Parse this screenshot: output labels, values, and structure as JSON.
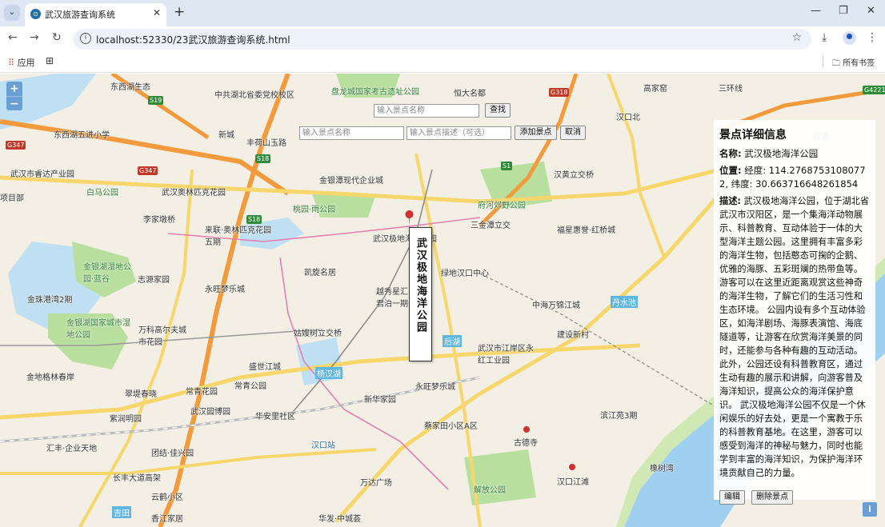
{
  "browser": {
    "tab_title": "武汉旅游查询系统",
    "tab_close": "✕",
    "new_tab": "+",
    "minimize": "—",
    "restore": "❐",
    "close": "✕",
    "url": "localhost:52330/23武汉旅游查询系统.html",
    "bookmarks_apps": "应用",
    "bookmarks_all": "所有书签"
  },
  "map": {
    "zoom_in": "+",
    "zoom_out": "−",
    "info": "i",
    "labels": [
      "中共湖北省委党校校区",
      "盘龙城国家考古遗址公园",
      "恒大名都",
      "高家窑",
      "东西湖生态",
      "后湖",
      "三环线",
      "汉口北",
      "东西湖五进小学",
      "丰荷山玉路",
      "新城",
      "武汉市睿达产业园",
      "白马公园",
      "武汉奥林匹克花园",
      "李家墩桥",
      "桃园·雨公园",
      "金银潭现代企业城",
      "府河郊野公园",
      "汉黄立交桥",
      "三金潭立交",
      "福星惠誉·红桥城",
      "武汉极地海洋公园",
      "来联·奥林匹克花园五期",
      "凯旋名居",
      "绿地汉口中心",
      "志源家园",
      "金银湖湿地公园·蓝谷",
      "永旺梦乐城",
      "越秀星汇君泊一期",
      "金珠港湾2期",
      "中海万锦江城",
      "丹水池",
      "金银湖国家城市湿地公园",
      "万科高尔夫城市花园",
      "姑嫂树立交桥",
      "后湖",
      "建设新村",
      "盛世江城",
      "杨汉湖",
      "武汉市江岸区永红工业园",
      "金地格林春岸",
      "常青花园",
      "永旺梦乐城",
      "常青公园",
      "新华家园",
      "翠堤春晓",
      "武汉园博园",
      "紫润明园",
      "华安里社区",
      "蔡家田小区A区",
      "滨江苑3期",
      "汉口站",
      "古德寺",
      "汇丰·企业天地",
      "团结·佳兴园",
      "长丰大道高架",
      "万达广场",
      "解放公园",
      "汉口江滩",
      "橡树湾",
      "云鹤小区",
      "吉田",
      "香江家居",
      "华发·中城荟",
      "项目部"
    ],
    "road_badges": [
      "S19",
      "G347",
      "G347",
      "S18",
      "S18",
      "S1",
      "G318",
      "G4221"
    ]
  },
  "search": {
    "name_placeholder": "输入景点名称",
    "find_label": "查找",
    "add_name_placeholder": "输入景点名称",
    "add_desc_placeholder": "输入景点描述（可选）",
    "add_label": "添加景点",
    "cancel_label": "取消"
  },
  "popup": {
    "title": "武汉极地海洋公园"
  },
  "detail": {
    "heading": "景点详细信息",
    "name_key": "名称:",
    "name_value": "武汉极地海洋公园",
    "location_key": "位置:",
    "location_value": "经度: 114.27687531080772, 纬度: 30.663716648261854",
    "desc_key": "描述:",
    "desc_value": "武汉极地海洋公园，位于湖北省武汉市汉阳区，是一个集海洋动物展示、科普教育、互动体验于一体的大型海洋主题公园。这里拥有丰富多彩的海洋生物，包括憨态可掬的企鹅、优雅的海豚、五彩斑斓的热带鱼等。游客可以在这里近距离观赏这些神奇的海洋生物，了解它们的生活习性和生态环境。 公园内设有多个互动体验区，如海洋剧场、海豚表演馆、海底隧道等，让游客在欣赏海洋美景的同时，还能参与各种有趣的互动活动。此外，公园还设有科普教育区，通过生动有趣的展示和讲解，向游客普及海洋知识，提高公众的海洋保护意识。 武汉极地海洋公园不仅是一个休闲娱乐的好去处，更是一个寓教于乐的科普教育基地。在这里，游客可以感受到海洋的神秘与魅力，同时也能学到丰富的海洋知识，为保护海洋环境贡献自己的力量。",
    "edit_label": "编辑",
    "delete_label": "删除景点"
  },
  "colors": {
    "expressway": "#f39a3c",
    "arterial": "#f7d66b",
    "river": "#9fd0f0",
    "park": "#b9df9f",
    "zoom_control": "#6a9fd4"
  }
}
